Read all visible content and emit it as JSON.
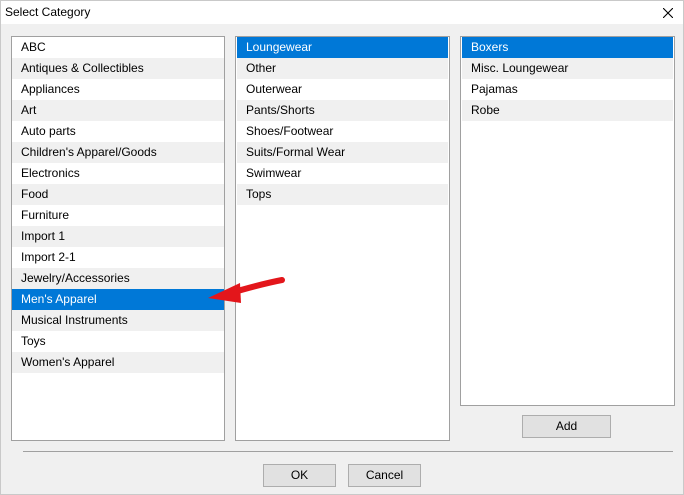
{
  "window": {
    "title": "Select Category"
  },
  "categories": [
    "ABC",
    "Antiques & Collectibles",
    "Appliances",
    "Art",
    "Auto parts",
    "Children's Apparel/Goods",
    "Electronics",
    "Food",
    "Furniture",
    "Import 1",
    "Import 2-1",
    "Jewelry/Accessories",
    "Men's Apparel",
    "Musical Instruments",
    "Toys",
    "Women's Apparel"
  ],
  "categories_selected": "Men's Apparel",
  "subcategories": [
    "Loungewear",
    "Other",
    "Outerwear",
    "Pants/Shorts",
    "Shoes/Footwear",
    "Suits/Formal Wear",
    "Swimwear",
    "Tops"
  ],
  "subcategories_selected": "Loungewear",
  "items": [
    "Boxers",
    "Misc. Loungewear",
    "Pajamas",
    "Robe"
  ],
  "items_selected": "Boxers",
  "buttons": {
    "add": "Add",
    "ok": "OK",
    "cancel": "Cancel"
  },
  "colors": {
    "selection": "#0078d7",
    "annotation_arrow": "#e3161b"
  },
  "icons": {
    "close": "close-icon",
    "annotation": "red-arrow-icon"
  }
}
